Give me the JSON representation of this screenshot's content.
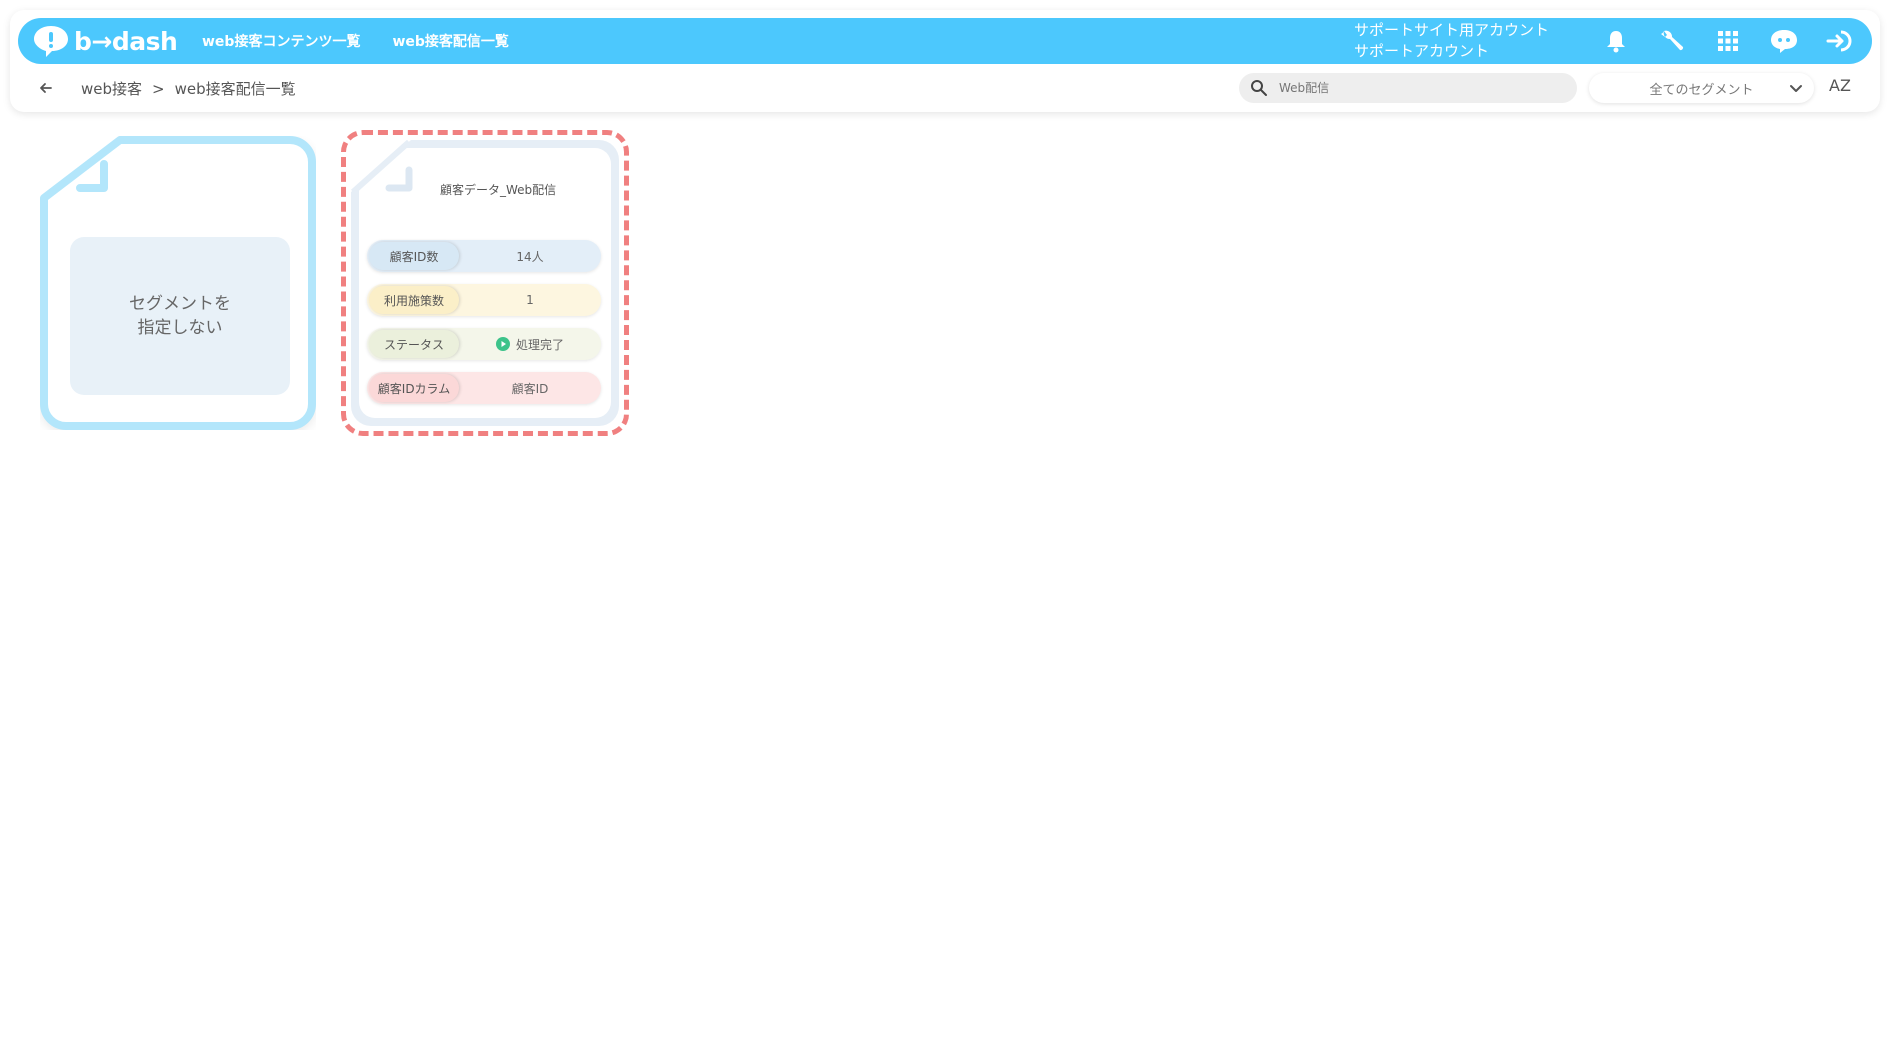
{
  "header": {
    "logo_text": "b→dash",
    "nav": [
      {
        "label": "web接客コンテンツ一覧"
      },
      {
        "label": "web接客配信一覧"
      }
    ],
    "account_line1": "サポートサイト用アカウント",
    "account_line2": "サポートアカウント",
    "icons": [
      "bell-icon",
      "wrench-icon",
      "grid-icon",
      "chat-bot-icon",
      "logout-icon"
    ]
  },
  "subbar": {
    "breadcrumb": [
      "web接客",
      ">",
      "web接客配信一覧"
    ],
    "search_placeholder": "Web配信",
    "segment_select": "全てのセグメント",
    "sort_label": "AZ"
  },
  "cards": {
    "no_segment": {
      "line1": "セグメントを",
      "line2": "指定しない"
    },
    "segment": {
      "title": "顧客データ_Web配信",
      "rows": [
        {
          "label": "顧客ID数",
          "value": "14人"
        },
        {
          "label": "利用施策数",
          "value": "1"
        },
        {
          "label": "ステータス",
          "value": "処理完了"
        },
        {
          "label": "顧客IDカラム",
          "value": "顧客ID"
        }
      ]
    }
  },
  "colors": {
    "header_bg": "#4cc8fd",
    "highlight_dash": "#f08080",
    "status_ok": "#3cc38a"
  }
}
